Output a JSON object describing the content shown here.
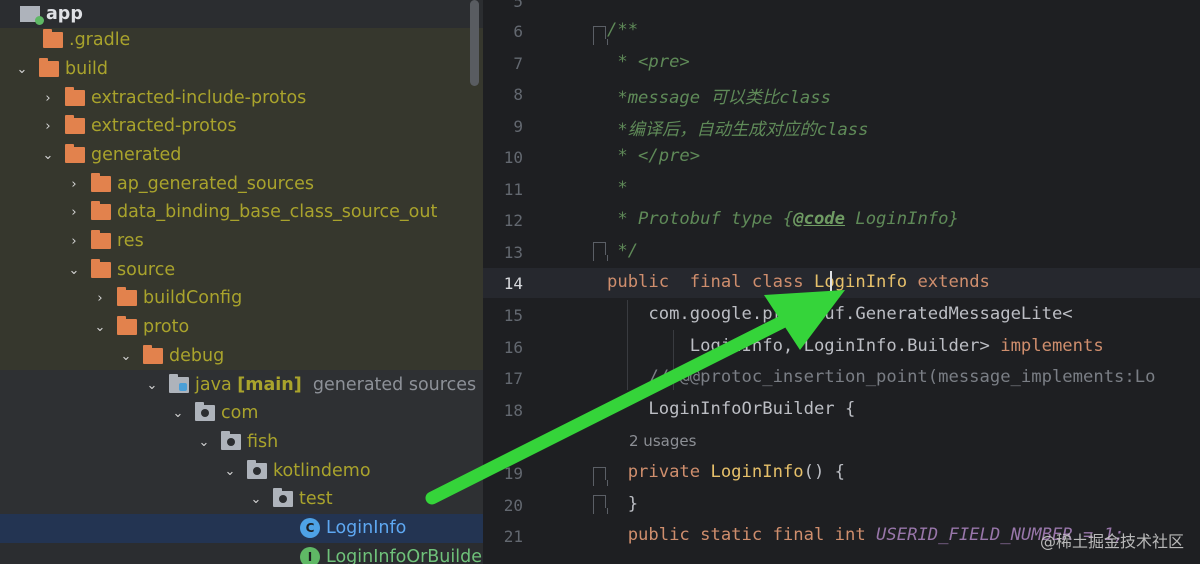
{
  "tree": {
    "rows": [
      {
        "label": "app",
        "extra": "",
        "extra2": ""
      },
      {
        "label": ".gradle"
      },
      {
        "label": "build"
      },
      {
        "label": "extracted-include-protos"
      },
      {
        "label": "extracted-protos"
      },
      {
        "label": "generated"
      },
      {
        "label": "ap_generated_sources"
      },
      {
        "label": "data_binding_base_class_source_out"
      },
      {
        "label": "res"
      },
      {
        "label": "source"
      },
      {
        "label": "buildConfig"
      },
      {
        "label": "proto"
      },
      {
        "label": "debug"
      },
      {
        "label": "java",
        "extra": "[main]",
        "extra2": "generated sources r"
      },
      {
        "label": "com"
      },
      {
        "label": "fish"
      },
      {
        "label": "kotlindemo"
      },
      {
        "label": "test"
      },
      {
        "label": "LoginInfo",
        "icon_letter": "C"
      },
      {
        "label": "LoginInfoOrBuilder",
        "icon_letter": "I"
      }
    ]
  },
  "editor": {
    "line_numbers": [
      "5",
      "6",
      "7",
      "8",
      "9",
      "10",
      "11",
      "12",
      "13",
      "14",
      "15",
      "16",
      "17",
      "18",
      "19",
      "20",
      "21"
    ],
    "lines": {
      "l6_open": "/**",
      "l7": " * <pre>",
      "l8_a": " *message ",
      "l8_b": "可以类比class",
      "l9": " *编译后，自动生成对应的class",
      "l10": " * </pre>",
      "l11": " *",
      "l12_a": " * Protobuf type {",
      "l12_b": "@code",
      "l12_c": " LoginInfo}",
      "l13": " */",
      "l14_a": "public",
      "l14_b": "  final class ",
      "l14_c": "LoginInfo",
      "l14_d": " extends",
      "l15_a": "    com.google.",
      "l15_b": "protobuf.GeneratedMessageLite<",
      "l16_a": "        LoginInfo, LoginInfo.Builder>",
      "l16_b": " implements",
      "l17": "    // @@protoc_insertion_point(message_implements:Lo",
      "l18": "    LoginInfoOrBuilder {",
      "usages": "2 usages",
      "l19_a": "  private ",
      "l19_b": "LoginInfo",
      "l19_c": "() {",
      "l20": "  }",
      "l21_a": "  public static final int ",
      "l21_b": "USERID_FIEL",
      "l21_c": "D_NUMBER = 1;"
    }
  },
  "watermark": "@稀土掘金技术社区",
  "colors": {
    "arrow": "#35d43a",
    "tree_bg": "#2b2d30",
    "editor_bg": "#1e1f22",
    "selection": "#2e436e"
  }
}
